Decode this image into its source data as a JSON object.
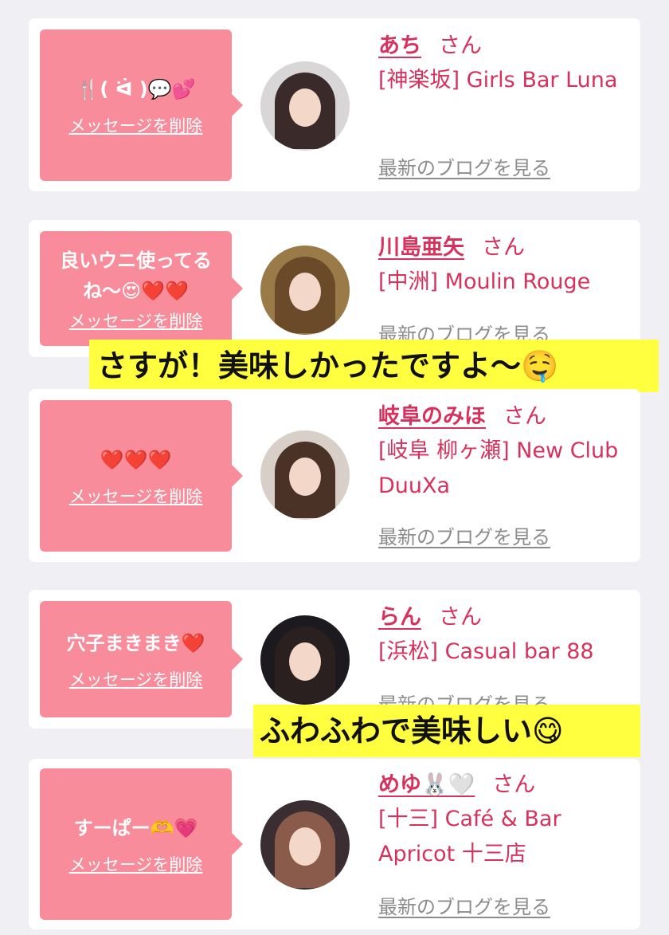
{
  "cards": [
    {
      "message": "🍴( ᐛ )💬💕",
      "delete_label": "メッセージを削除",
      "name": "あち",
      "honorific": "さん",
      "shop": "[神楽坂] Girls Bar Luna",
      "blog_link": "最新のブログを見る",
      "avatar_colors": [
        "#d9d6d8",
        "#3a2a2a"
      ]
    },
    {
      "message": "良いウニ使ってるね〜😍❤️❤️",
      "delete_label": "メッセージを削除",
      "name": "川島亜矢",
      "honorific": "さん",
      "shop": "[中洲] Moulin Rouge",
      "blog_link": "最新のブログを見る",
      "avatar_colors": [
        "#9a7a46",
        "#6b4a2a"
      ]
    },
    {
      "message": "❤️❤️❤️",
      "delete_label": "メッセージを削除",
      "name": "岐阜のみほ",
      "honorific": "さん",
      "shop": "[岐阜 柳ヶ瀬] New Club DuuXa",
      "blog_link": "最新のブログを見る",
      "avatar_colors": [
        "#d8cfc9",
        "#4a3226"
      ]
    },
    {
      "message": "穴子まきまき❤️",
      "delete_label": "メッセージを削除",
      "name": "らん",
      "honorific": "さん",
      "shop": "[浜松] Casual bar 88",
      "blog_link": "最新のブログを見る",
      "avatar_colors": [
        "#1c1a1e",
        "#2b2020"
      ]
    },
    {
      "message": "すーぱー🫶💗",
      "delete_label": "メッセージを削除",
      "name": "めゆ🐰🤍",
      "honorific": "さん",
      "shop": "[十三] Café & Bar Apricot 十三店",
      "blog_link": "最新のブログを見る",
      "avatar_colors": [
        "#3a2e33",
        "#8a5a4a"
      ]
    }
  ],
  "captions": [
    {
      "text": "さすが！美味しかったですよ〜🤤"
    },
    {
      "text": "ふわふわで美味しい😋"
    }
  ]
}
